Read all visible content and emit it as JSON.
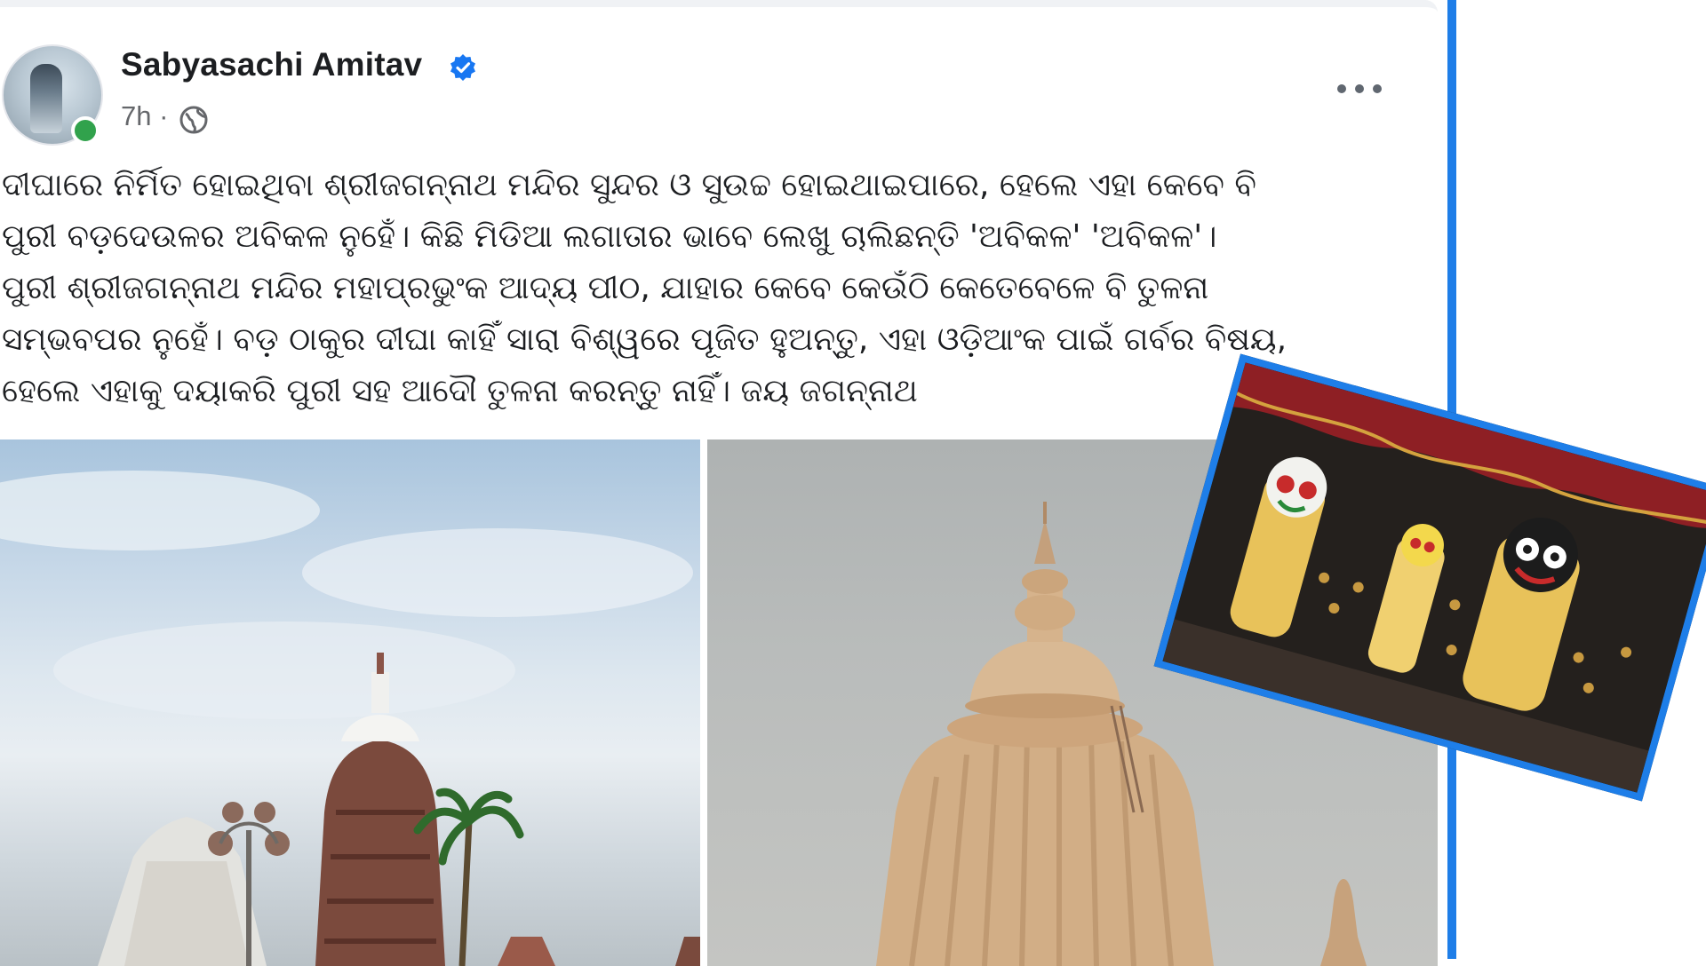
{
  "post": {
    "author": "Sabyasachi Amitav",
    "verified": true,
    "timestamp": "7h",
    "separator": "·",
    "audience_icon": "globe-icon",
    "more_icon": "more-options-icon",
    "text_lines": [
      "ଦୀଘାରେ ନିର୍ମିତ ହୋଇଥିବା ଶ୍ରୀଜଗନ୍ନାଥ ମନ୍ଦିର ସୁନ୍ଦର ଓ ସୁଉଚ୍ଚ ହୋଇଥାଇପାରେ, ହେଲେ ଏହା କେବେ ବି",
      "ପୁରୀ ବଡ଼ଦେଉଳର ଅବିକଳ ନୁହେଁ। କିଛି ମିଡିଆ ଲଗାତାର ଭାବେ ଲେଖୁ ଚାଲିଛନ୍ତି 'ଅବିକଳ' 'ଅବିକଳ'।",
      "ପୁରୀ ଶ୍ରୀଜଗନ୍ନାଥ ମନ୍ଦିର ମହାପ୍ରଭୁଂକ ଆଦ୍ୟ ପୀଠ, ଯାହାର କେବେ କେଉଁଠି କେତେବେଳେ ବି ତୁଳନା",
      "ସମ୍ଭବପର ନୁହେଁ। ବଡ଼ ଠାକୁର ଦୀଘା କାହିଁ ସାରା ବିଶ୍ୱରେ ପୂଜିତ ହୁଅନ୍ତୁ, ଏହା ଓଡ଼ିଆଂକ ପାଇଁ ଗର୍ବର ବିଷୟ,",
      "ହେଲେ ଏହାକୁ ଦୟାକରି ପୁରୀ ସହ ଆଦୌ ତୁଳନା କରନ୍ତୁ ନାହିଁ। ଜୟ ଜଗନ୍ନାଥ"
    ]
  },
  "colors": {
    "accent_blue": "#1e7ee8",
    "verified_blue": "#1877f2",
    "online_green": "#31a24c",
    "text_primary": "#1c1e21",
    "text_secondary": "#65676b"
  }
}
